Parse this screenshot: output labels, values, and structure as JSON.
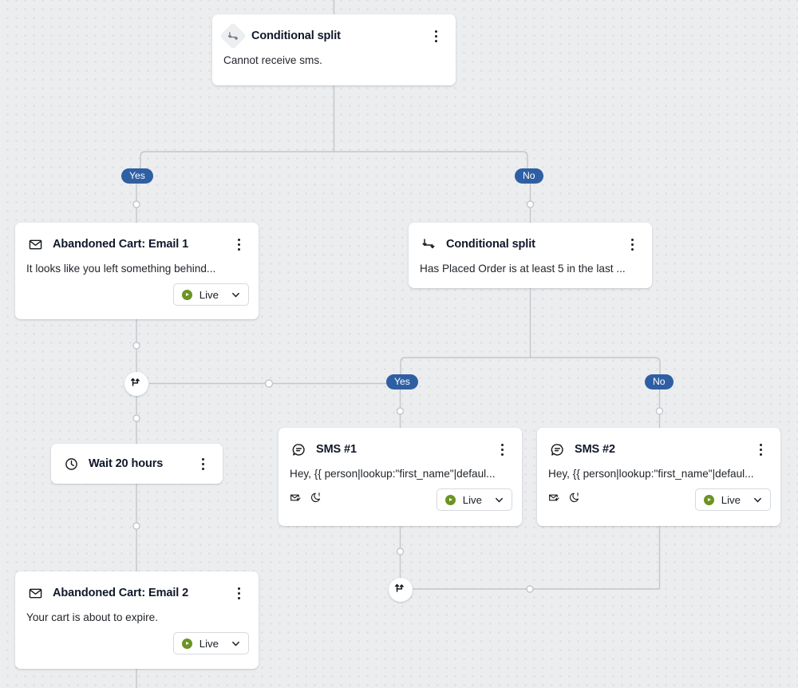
{
  "canvas": {
    "background_color": "#ebedef",
    "dot_color": "#d8dadd",
    "edge_color": "#c3c7cc",
    "branch_badge_color": "#2f5fa3",
    "live_green": "#6b9424"
  },
  "nodes": {
    "conditional_split_top": {
      "icon": "conditional-split-icon",
      "title": "Conditional split",
      "body": "Cannot receive sms.",
      "menu": "kebab-menu-icon"
    },
    "email_1": {
      "icon": "envelope-icon",
      "title": "Abandoned Cart: Email 1",
      "body": "It looks like you left something behind...",
      "status": {
        "label": "Live",
        "icon": "play-circle-icon",
        "chevron": "chevron-down-icon"
      },
      "menu": "kebab-menu-icon"
    },
    "conditional_split_right": {
      "icon": "conditional-split-icon",
      "title": "Conditional split",
      "body": "Has Placed Order is at least 5 in the last ...",
      "menu": "kebab-menu-icon"
    },
    "wait": {
      "icon": "clock-icon",
      "title": "Wait 20 hours",
      "menu": "kebab-menu-icon"
    },
    "sms_1": {
      "icon": "sms-bubble-icon",
      "title": "SMS #1",
      "body": "Hey, {{ person|lookup:\"first_name\"|defaul...",
      "footer_icons": [
        "smart-sending-icon",
        "quiet-hours-icon"
      ],
      "status": {
        "label": "Live",
        "icon": "play-circle-icon",
        "chevron": "chevron-down-icon"
      },
      "menu": "kebab-menu-icon"
    },
    "sms_2": {
      "icon": "sms-bubble-icon",
      "title": "SMS #2",
      "body": "Hey, {{ person|lookup:\"first_name\"|defaul...",
      "footer_icons": [
        "smart-sending-icon",
        "quiet-hours-icon"
      ],
      "status": {
        "label": "Live",
        "icon": "play-circle-icon",
        "chevron": "chevron-down-icon"
      },
      "menu": "kebab-menu-icon"
    },
    "email_2": {
      "icon": "envelope-icon",
      "title": "Abandoned Cart: Email 2",
      "body": "Your cart is about to expire.",
      "status": {
        "label": "Live",
        "icon": "play-circle-icon",
        "chevron": "chevron-down-icon"
      },
      "menu": "kebab-menu-icon"
    },
    "merge_left": {
      "icon": "rejoin-paths-icon"
    },
    "merge_bottom": {
      "icon": "rejoin-paths-icon"
    }
  },
  "branches": {
    "top_yes": "Yes",
    "top_no": "No",
    "right_yes": "Yes",
    "right_no": "No"
  }
}
